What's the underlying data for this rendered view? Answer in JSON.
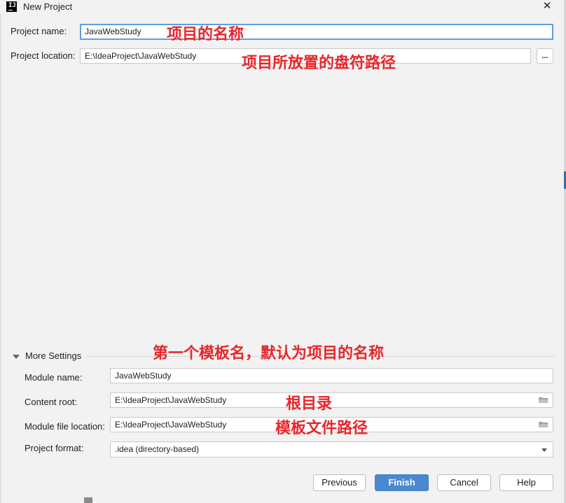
{
  "window": {
    "title": "New Project",
    "close_glyph": "✕",
    "app_icon_text": "IJ"
  },
  "project_name": {
    "label": "Project name:",
    "value": "JavaWebStudy"
  },
  "project_location": {
    "label": "Project location:",
    "value": "E:\\IdeaProject\\JavaWebStudy",
    "browse_label": "..."
  },
  "annotations": {
    "name": "项目的名称",
    "location": "项目所放置的盘符路径",
    "module_name": "第一个模板名，默认为项目的名称",
    "content_root": "根目录",
    "module_file": "模板文件路径"
  },
  "more_settings": {
    "label": "More Settings",
    "module_name": {
      "label": "Module name:",
      "value": "JavaWebStudy"
    },
    "content_root": {
      "label": "Content root:",
      "value": "E:\\IdeaProject\\JavaWebStudy"
    },
    "module_file_location": {
      "label": "Module file location:",
      "value": "E:\\IdeaProject\\JavaWebStudy"
    },
    "project_format": {
      "label": "Project format:",
      "value": ".idea (directory-based)"
    }
  },
  "buttons": {
    "previous": "Previous",
    "finish": "Finish",
    "cancel": "Cancel",
    "help": "Help"
  },
  "colors": {
    "accent": "#4a89cf",
    "annotation": "#e8262a",
    "focus": "#5d9fe0"
  },
  "icons": [
    "app-icon",
    "close-icon",
    "folder-icon",
    "expand-triangle-icon",
    "dropdown-arrow-icon"
  ]
}
